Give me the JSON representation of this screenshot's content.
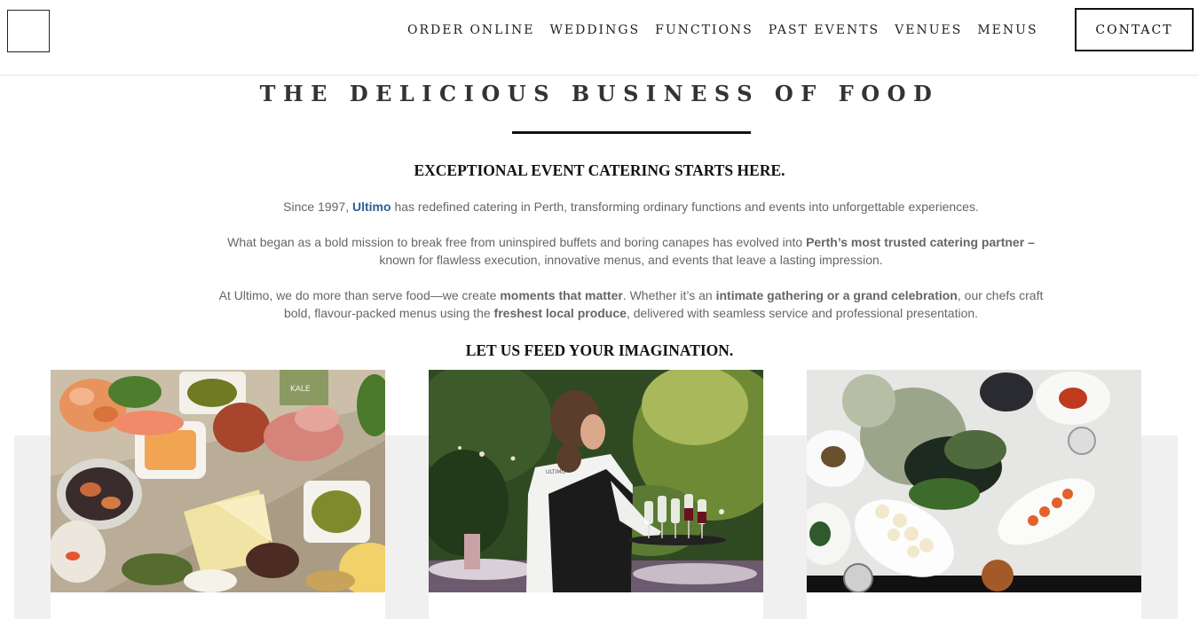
{
  "header": {
    "logo_label": "",
    "nav": [
      "ORDER ONLINE",
      "WEDDINGS",
      "FUNCTIONS",
      "PAST EVENTS",
      "VENUES",
      "MENUS"
    ],
    "contact_label": "CONTACT"
  },
  "main": {
    "title": "THE DELICIOUS BUSINESS OF FOOD",
    "subheading": "EXCEPTIONAL EVENT CATERING STARTS HERE.",
    "para1": {
      "before": "Since 1997, ",
      "brand": "Ultimo",
      "after": " has redefined catering in Perth, transforming ordinary functions and events into unforgettable experiences."
    },
    "para2": {
      "before": "What began as a bold mission to break free from uninspired buffets and boring canapes has evolved into ",
      "bold": "Perth’s most trusted catering partner –",
      "after": " known for flawless execution, innovative menus, and events that leave a lasting impression."
    },
    "para3": {
      "part1": "At Ultimo, we do more than serve food—we create ",
      "bold1": "moments that matter",
      "part2": ". Whether it’s an ",
      "bold2": "intimate gathering or a grand celebration",
      "part3": ", our chefs craft bold, flavour-packed menus using the ",
      "bold3": "freshest local produce",
      "part4": ", delivered with seamless service and professional presentation."
    },
    "cta_heading": "LET US FEED YOUR IMAGINATION."
  },
  "gallery": [
    {
      "caption": "",
      "icon": "grazing-platter-photo"
    },
    {
      "caption": "",
      "icon": "waiter-serving-wine-photo",
      "apron_text": "ULTIMO"
    },
    {
      "caption": "",
      "icon": "plated-canapes-table-photo"
    }
  ],
  "colors": {
    "brand": "#2c5f94",
    "text": "#666666",
    "heading": "#333333",
    "band": "#f0f0f0"
  }
}
